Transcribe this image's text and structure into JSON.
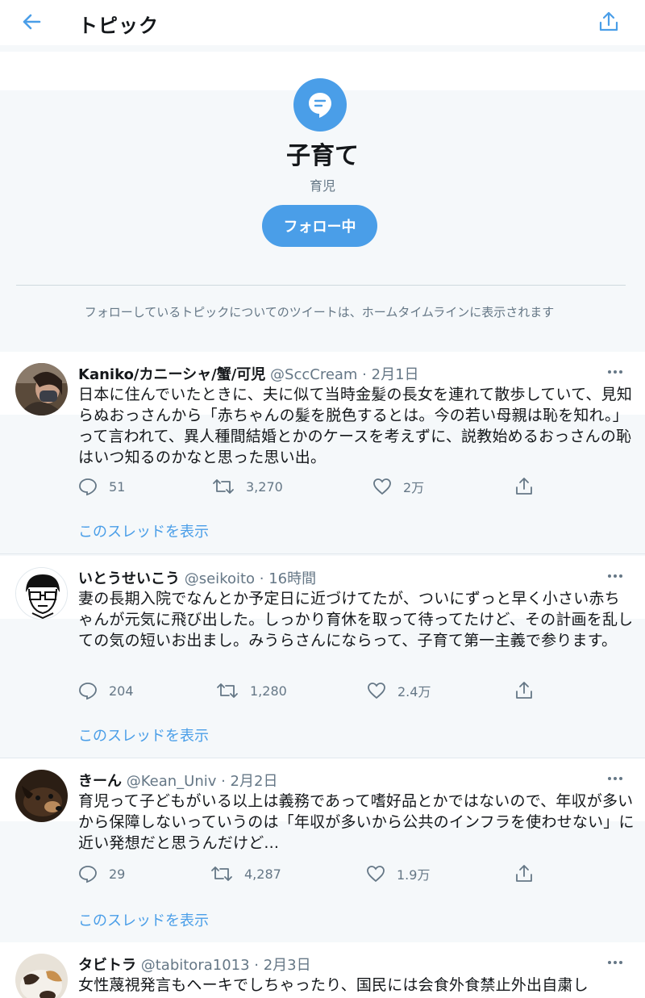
{
  "header": {
    "title": "トピック"
  },
  "topic": {
    "title": "子育て",
    "subtitle": "育児",
    "follow_label": "フォロー中",
    "note": "フォローしているトピックについてのツイートは、ホームタイムラインに表示されます"
  },
  "colors": {
    "accent": "#4a9ee8",
    "text": "#14171a",
    "muted": "#657786",
    "background": "#f5f8fa"
  },
  "tweets": [
    {
      "name": "Kaniko/カニーシャ/蟹/可児",
      "handle": "@SccCream",
      "time": "2月1日",
      "meta": "@SccCream · 2月1日",
      "text": "日本に住んでいたときに、夫に似て当時金髪の長女を連れて散歩していて、見知らぬおっさんから「赤ちゃんの髪を脱色するとは。今の若い母親は恥を知れ。」って言われて、異人種間結婚とかのケースを考えずに、説教始めるおっさんの恥はいつ知るのかなと思った思い出。",
      "replies": "51",
      "retweets": "3,270",
      "likes": "2万",
      "thread_link": "このスレッドを表示"
    },
    {
      "name": "いとうせいこう",
      "handle": "@seikoito",
      "time": "16時間",
      "meta": "@seikoito · 16時間",
      "text": "妻の長期入院でなんとか予定日に近づけてたが、ついにずっと早く小さい赤ちゃんが元気に飛び出した。しっかり育休を取って待ってたけど、その計画を乱しての気の短いお出まし。みうらさんにならって、子育て第一主義で参ります。",
      "replies": "204",
      "retweets": "1,280",
      "likes": "2.4万",
      "thread_link": "このスレッドを表示"
    },
    {
      "name": "きーん",
      "handle": "@Kean_Univ",
      "time": "2月2日",
      "meta": "@Kean_Univ · 2月2日",
      "text": "育児って子どもがいる以上は義務であって嗜好品とかではないので、年収が多いから保障しないっていうのは「年収が多いから公共のインフラを使わせない」に近い発想だと思うんだけど...",
      "replies": "29",
      "retweets": "4,287",
      "likes": "1.9万",
      "thread_link": "このスレッドを表示"
    },
    {
      "name": "タビトラ",
      "handle": "@tabitora1013",
      "time": "2月3日",
      "meta": "@tabitora1013 · 2月3日",
      "text": "女性蔑視発言もヘーキでしちゃったり、国民には会食外食禁止外出自粛し"
    }
  ]
}
